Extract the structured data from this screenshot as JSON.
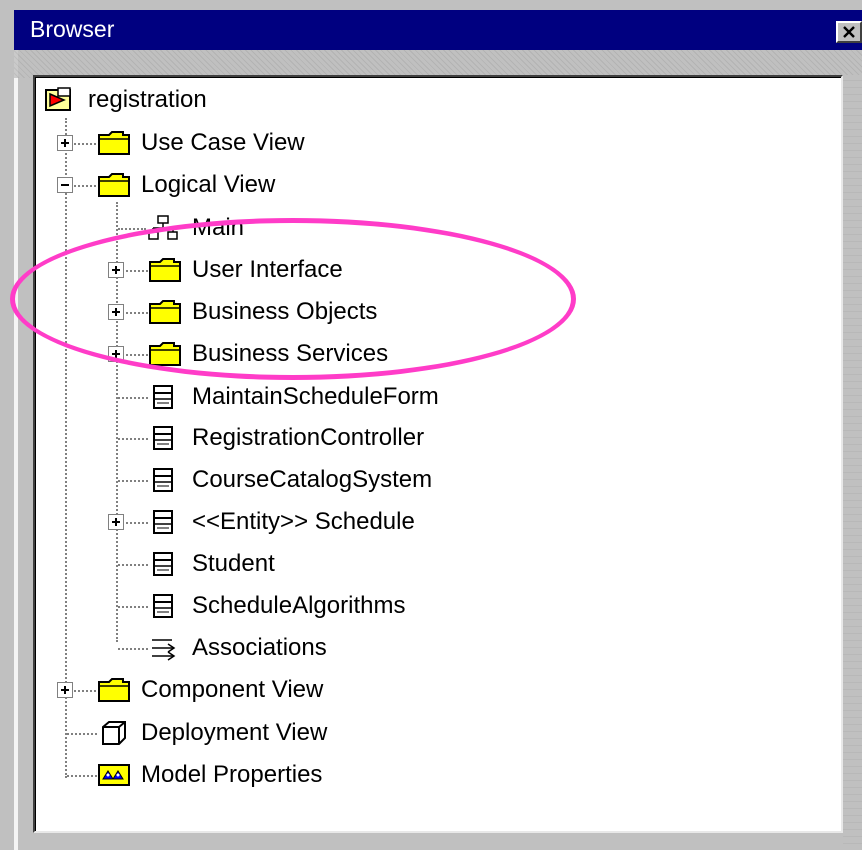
{
  "window": {
    "title": "Browser",
    "close_icon": "close-icon"
  },
  "colors": {
    "titlebar": "#000080",
    "highlight": "#ff3cc8",
    "folder": "#ffff00"
  },
  "tree": {
    "root": {
      "label": "registration",
      "icon": "model-icon"
    },
    "items": [
      {
        "label": "Use Case View",
        "icon": "folder-icon",
        "expander": "+"
      },
      {
        "label": "Logical View",
        "icon": "folder-icon",
        "expander": "-"
      },
      {
        "label": "Main",
        "icon": "class-diagram-icon"
      },
      {
        "label": "User Interface",
        "icon": "folder-icon",
        "expander": "+"
      },
      {
        "label": "Business Objects",
        "icon": "folder-icon",
        "expander": "+"
      },
      {
        "label": "Business Services",
        "icon": "folder-icon",
        "expander": "+"
      },
      {
        "label": "MaintainScheduleForm",
        "icon": "class-icon"
      },
      {
        "label": "RegistrationController",
        "icon": "class-icon"
      },
      {
        "label": "CourseCatalogSystem",
        "icon": "class-icon"
      },
      {
        "label": "<<Entity>> Schedule",
        "icon": "class-icon",
        "expander": "+"
      },
      {
        "label": "Student",
        "icon": "class-icon"
      },
      {
        "label": "ScheduleAlgorithms",
        "icon": "class-icon"
      },
      {
        "label": "Associations",
        "icon": "associations-icon"
      },
      {
        "label": "Component View",
        "icon": "folder-icon",
        "expander": "+"
      },
      {
        "label": "Deployment View",
        "icon": "deployment-cube-icon"
      },
      {
        "label": "Model Properties",
        "icon": "model-properties-icon"
      }
    ]
  }
}
